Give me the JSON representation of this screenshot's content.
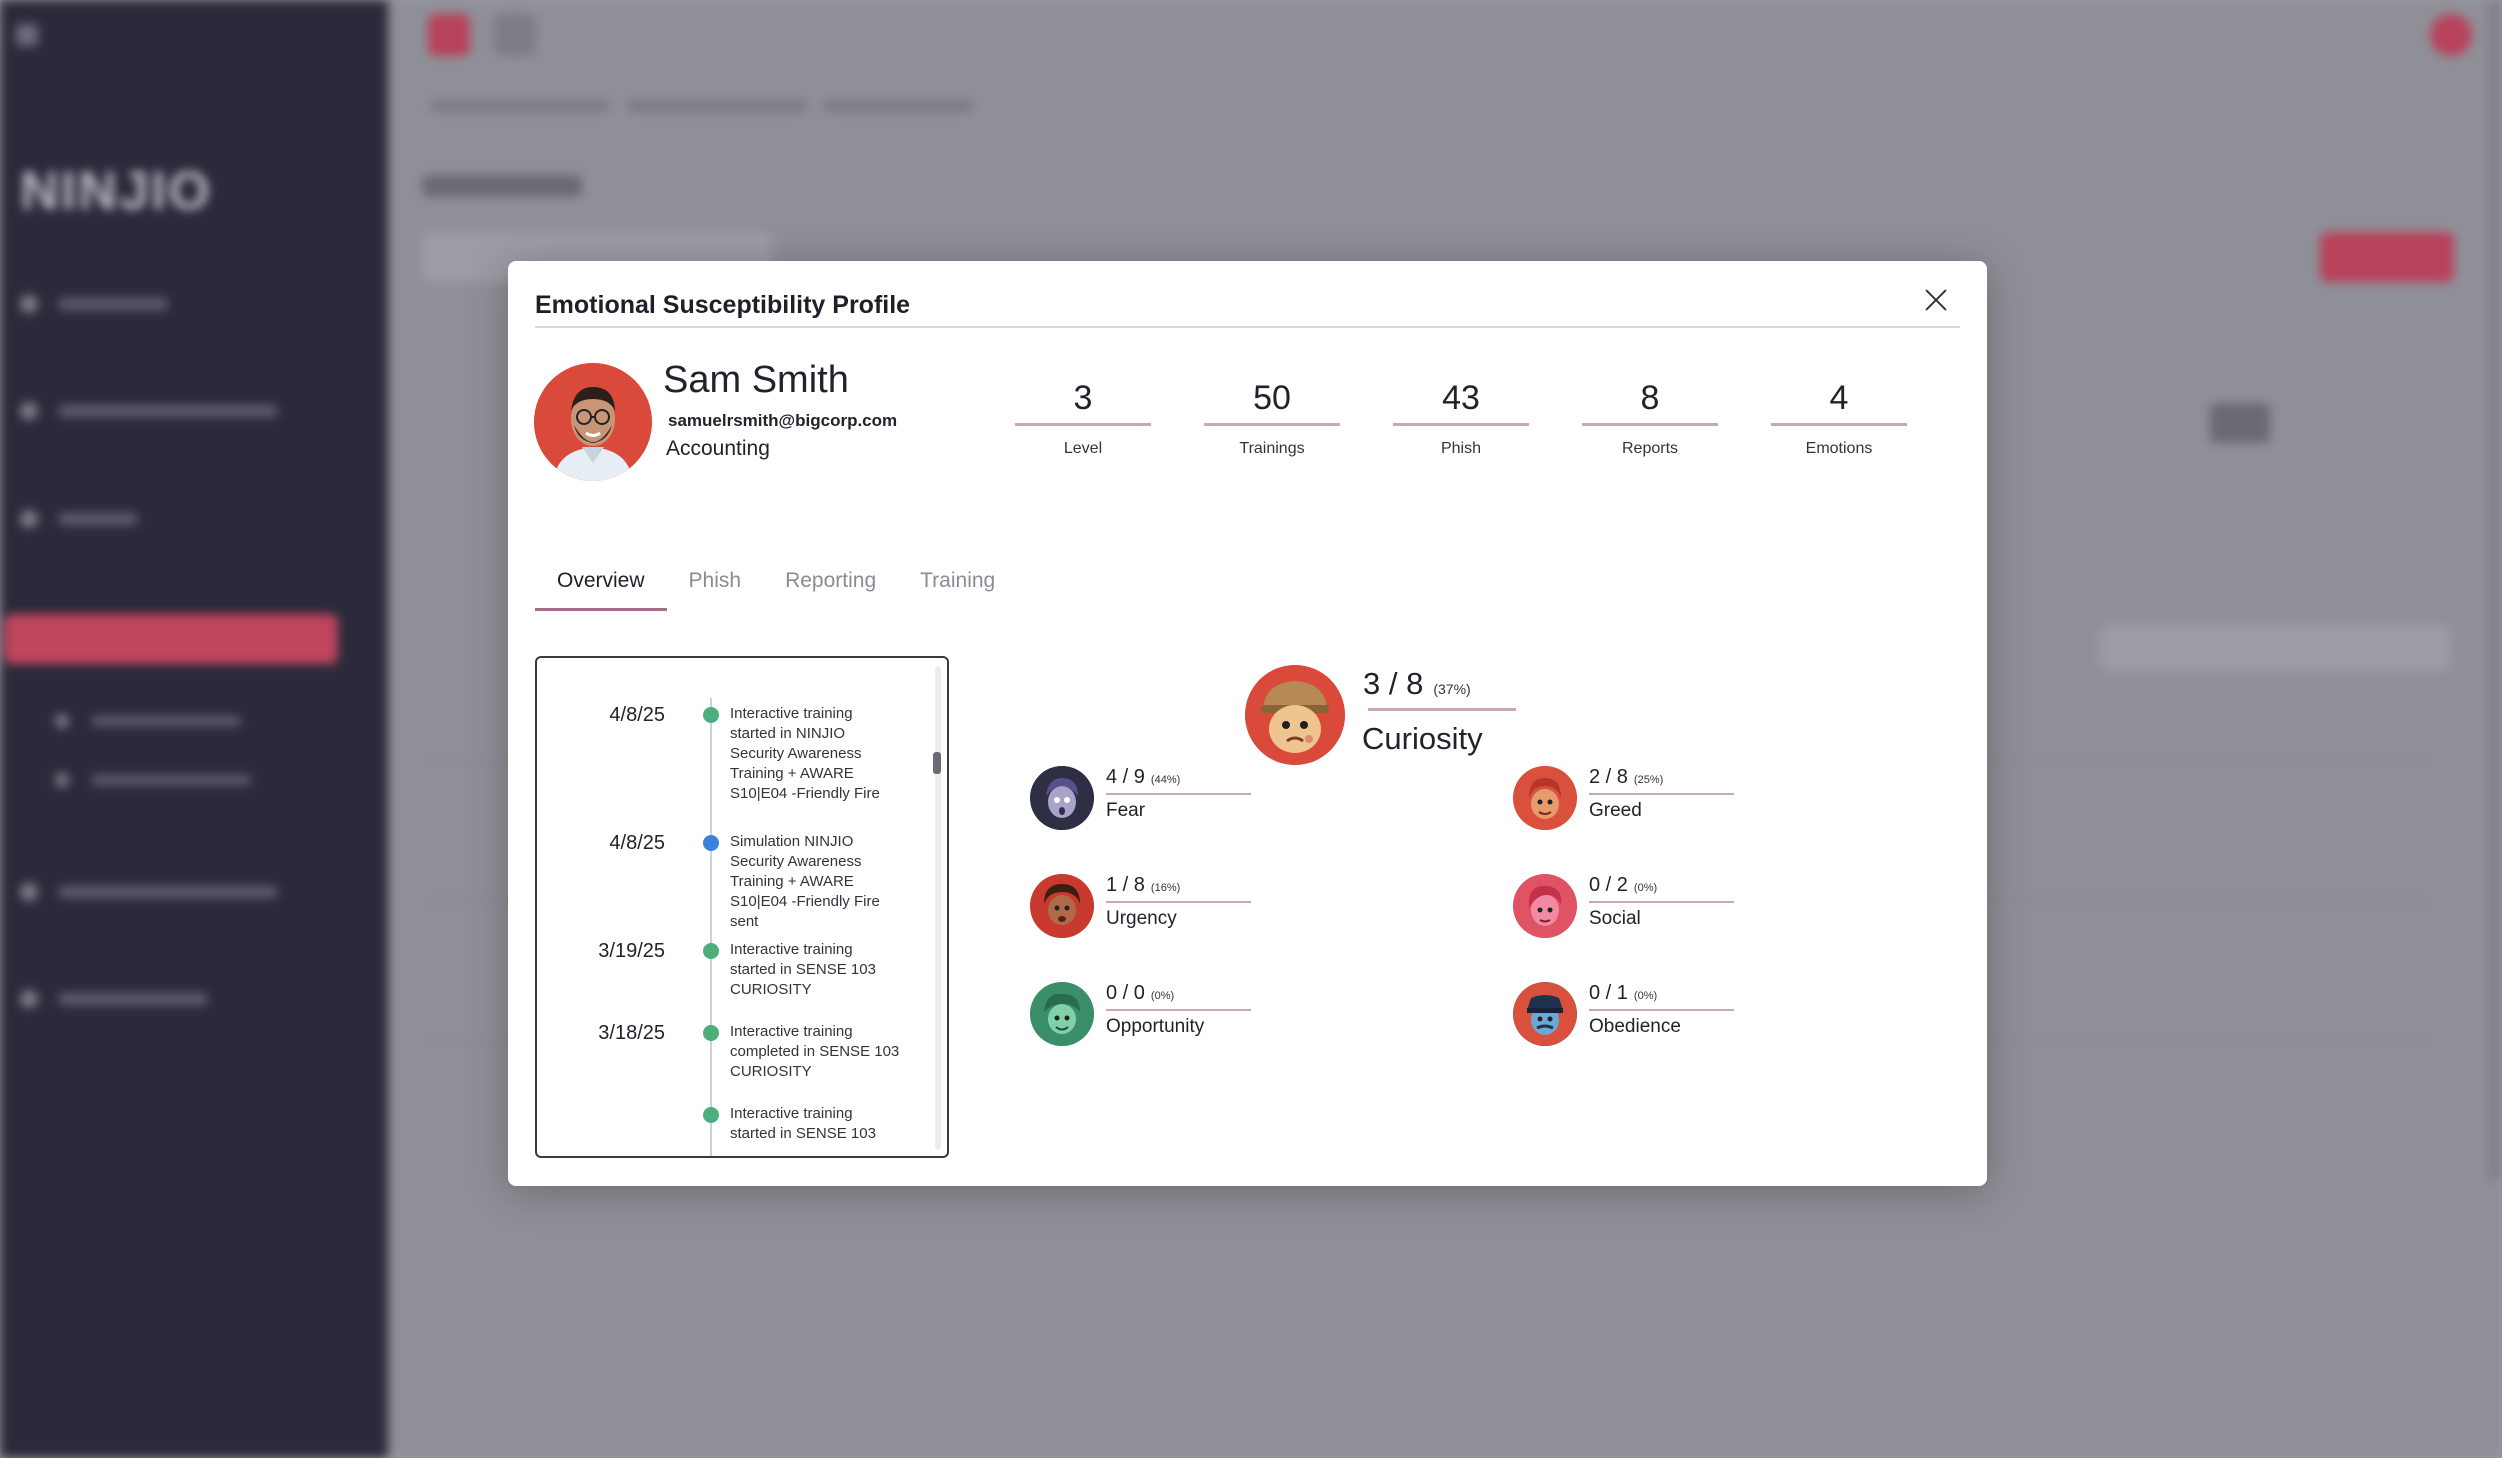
{
  "background": {
    "logo": "NINJIO"
  },
  "modal": {
    "title": "Emotional Susceptibility Profile",
    "user": {
      "name": "Sam Smith",
      "email": "samuelrsmith@bigcorp.com",
      "department": "Accounting"
    },
    "stats": [
      {
        "value": "3",
        "label": "Level"
      },
      {
        "value": "50",
        "label": "Trainings"
      },
      {
        "value": "43",
        "label": "Phish"
      },
      {
        "value": "8",
        "label": "Reports"
      },
      {
        "value": "4",
        "label": "Emotions"
      }
    ],
    "tabs": [
      "Overview",
      "Phish",
      "Reporting",
      "Training"
    ],
    "active_tab": "Overview",
    "timeline": [
      {
        "date": "4/8/25",
        "text": "Interactive training started in NINJIO Security Awareness Training + AWARE S10|E04 -Friendly Fire",
        "color": "#4caf7a"
      },
      {
        "date": "4/8/25",
        "text": "Simulation NINJIO Security Awareness Training + AWARE S10|E04 -Friendly Fire sent",
        "color": "#3b82e0"
      },
      {
        "date": "3/19/25",
        "text": "Interactive training started in SENSE 103 CURIOSITY",
        "color": "#4caf7a"
      },
      {
        "date": "3/18/25",
        "text": "Interactive training completed in SENSE 103 CURIOSITY",
        "color": "#4caf7a"
      },
      {
        "date": "",
        "text": "Interactive training started in SENSE 103",
        "color": "#4caf7a"
      }
    ],
    "featured": {
      "score": "3 / 8",
      "pct": "(37%)",
      "name": "Curiosity"
    },
    "emotions": [
      {
        "score": "4 / 9",
        "pct": "(44%)",
        "name": "Fear",
        "color": "#2e2e44"
      },
      {
        "score": "2 / 8",
        "pct": "(25%)",
        "name": "Greed",
        "color": "#d9503d"
      },
      {
        "score": "1 / 8",
        "pct": "(16%)",
        "name": "Urgency",
        "color": "#c93a2e"
      },
      {
        "score": "0 / 2",
        "pct": "(0%)",
        "name": "Social",
        "color": "#e05365"
      },
      {
        "score": "0 / 0",
        "pct": "(0%)",
        "name": "Opportunity",
        "color": "#3a8f6a"
      },
      {
        "score": "0 / 1",
        "pct": "(0%)",
        "name": "Obedience",
        "color": "#2f4a6e"
      }
    ]
  }
}
